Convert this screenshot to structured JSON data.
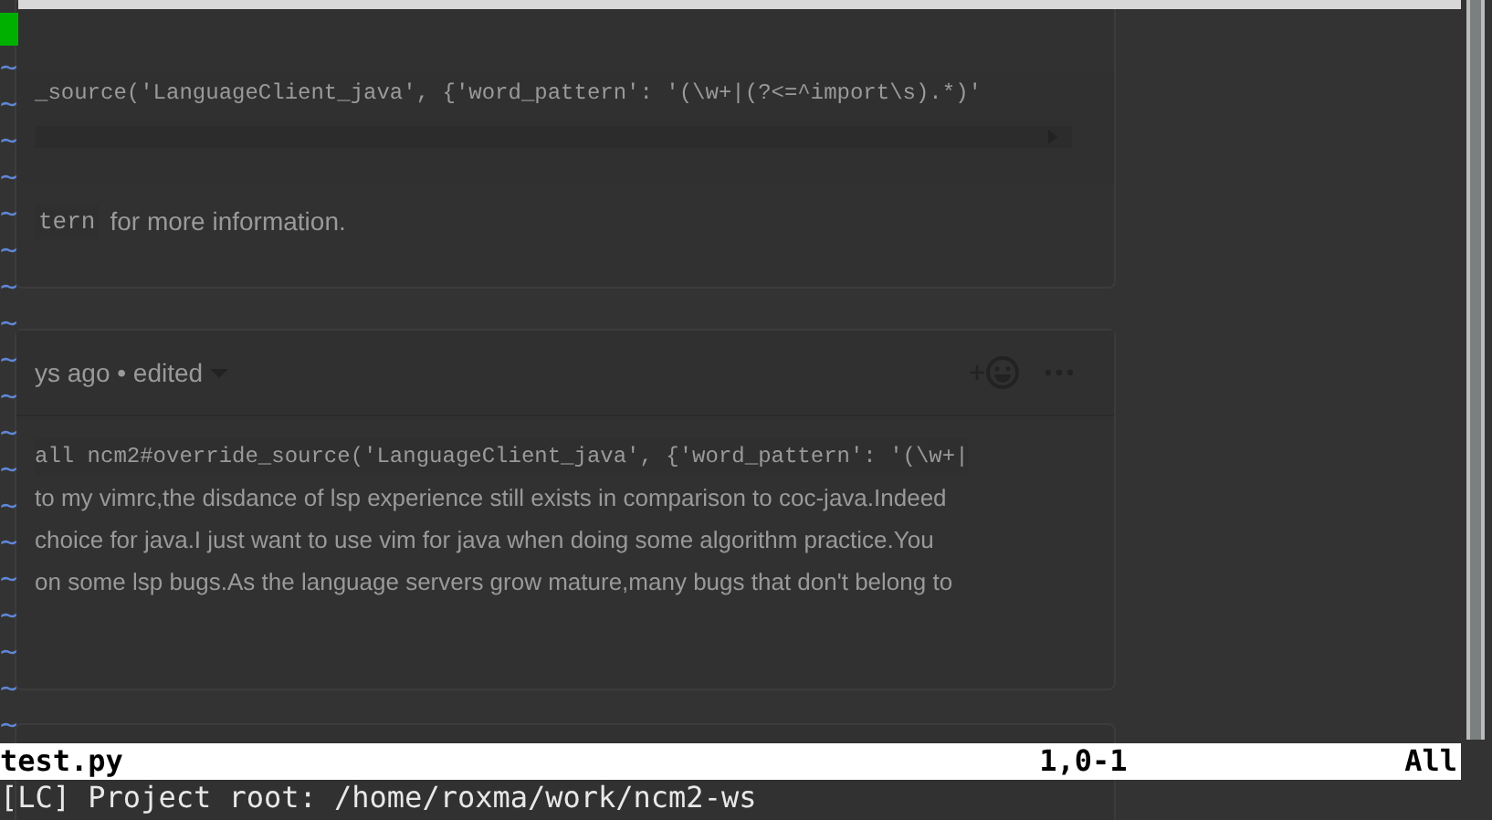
{
  "page": {
    "comment_1": {
      "code_line": "_source('LanguageClient_java', {'word_pattern': '(\\w+|(?<=^import\\s).*)'",
      "note_code": "tern",
      "note_text": "for more information."
    },
    "comment_2": {
      "meta": "ys ago • edited",
      "code_line": "all ncm2#override_source('LanguageClient_java', {'word_pattern': '(\\w+|",
      "paragraph_lines": [
        "to my vimrc,the disdance of lsp experience still exists in comparison to coc-java.Indeed",
        "choice for java.I just want to use vim for java when doing some algorithm practice.You",
        "on some lsp bugs.As the language servers grow mature,many bugs that don't belong to"
      ]
    }
  },
  "vim": {
    "empty_line_markers": [
      "~",
      "~",
      "~",
      "~",
      "~",
      "~",
      "~",
      "~",
      "~",
      "~",
      "~",
      "~",
      "~",
      "~",
      "~",
      "~",
      "~",
      "~",
      "~"
    ],
    "status_line": {
      "file": "test.py",
      "position": "1,0-1",
      "scroll": "All"
    },
    "message": "[LC] Project root: /home/roxma/work/ncm2-ws"
  }
}
